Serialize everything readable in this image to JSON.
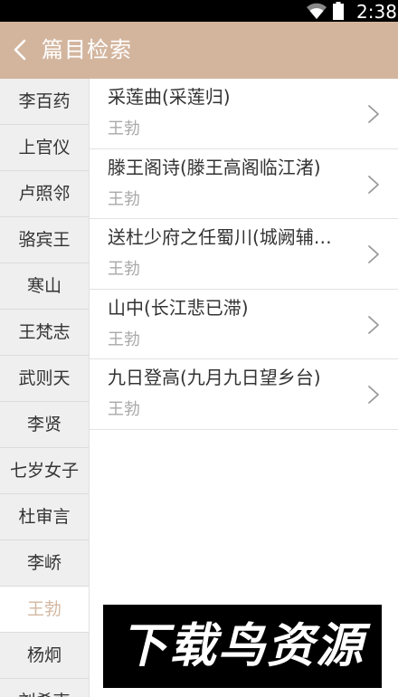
{
  "status_bar": {
    "time": "2:38",
    "icons": [
      "wifi-icon",
      "battery-icon"
    ]
  },
  "header": {
    "title": "篇目检索",
    "back_icon": "back-chevron-icon",
    "background_color": "#d3b59e"
  },
  "sidebar": {
    "active_index": 11,
    "active_color": "#d4b8a2",
    "items": [
      {
        "label": "李百药"
      },
      {
        "label": "上官仪"
      },
      {
        "label": "卢照邻"
      },
      {
        "label": "骆宾王"
      },
      {
        "label": "寒山"
      },
      {
        "label": "王梵志"
      },
      {
        "label": "武则天"
      },
      {
        "label": "李贤"
      },
      {
        "label": "七岁女子"
      },
      {
        "label": "杜审言"
      },
      {
        "label": "李峤"
      },
      {
        "label": "王勃"
      },
      {
        "label": "杨炯"
      },
      {
        "label": "刘希夷"
      }
    ]
  },
  "poems": {
    "items": [
      {
        "title": "采莲曲(采莲归)",
        "author": "王勃"
      },
      {
        "title": "滕王阁诗(滕王高阁临江渚)",
        "author": "王勃"
      },
      {
        "title": "送杜少府之任蜀川(城阙辅…",
        "author": "王勃"
      },
      {
        "title": "山中(长江悲已滞)",
        "author": "王勃"
      },
      {
        "title": "九日登高(九月九日望乡台)",
        "author": "王勃"
      }
    ]
  },
  "watermark": {
    "text": "下载鸟资源"
  }
}
